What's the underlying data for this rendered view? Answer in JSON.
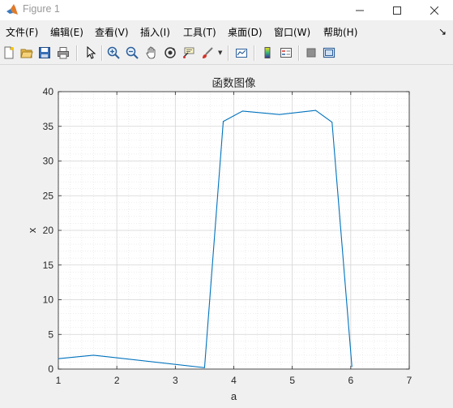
{
  "window": {
    "title": "Figure 1"
  },
  "menu": {
    "items": [
      {
        "label": "文件(F)"
      },
      {
        "label": "编辑(E)"
      },
      {
        "label": "查看(V)"
      },
      {
        "label": "插入(I)"
      },
      {
        "label": "工具(T)"
      },
      {
        "label": "桌面(D)"
      },
      {
        "label": "窗口(W)"
      },
      {
        "label": "帮助(H)"
      }
    ],
    "dock_icon": "↘"
  },
  "toolbar": {
    "icons": [
      "new-figure-icon",
      "open-file-icon",
      "save-icon",
      "print-icon",
      "pointer-icon",
      "zoom-in-icon",
      "zoom-out-icon",
      "pan-hand-icon",
      "rotate-3d-icon",
      "data-cursor-icon",
      "brush-icon",
      "link-plot-icon",
      "colorbar-icon",
      "legend-icon",
      "hide-plot-tools-icon",
      "show-plot-tools-icon"
    ]
  },
  "chart_data": {
    "type": "line",
    "title": "函数图像",
    "xlabel": "a",
    "ylabel": "x",
    "xlim": [
      1,
      7
    ],
    "ylim": [
      0,
      40
    ],
    "x_ticks": [
      "1",
      "2",
      "3",
      "4",
      "5",
      "6",
      "7"
    ],
    "y_ticks": [
      "0",
      "5",
      "10",
      "15",
      "20",
      "25",
      "30",
      "35",
      "40"
    ],
    "grid": true,
    "minor_grid": true,
    "series": [
      {
        "color": "#0072BD",
        "x": [
          1.0,
          1.6,
          3.5,
          3.82,
          4.15,
          4.78,
          5.4,
          5.68,
          6.02
        ],
        "y": [
          1.5,
          2.0,
          0.2,
          35.7,
          37.2,
          36.7,
          37.3,
          35.6,
          0.3
        ]
      }
    ]
  }
}
